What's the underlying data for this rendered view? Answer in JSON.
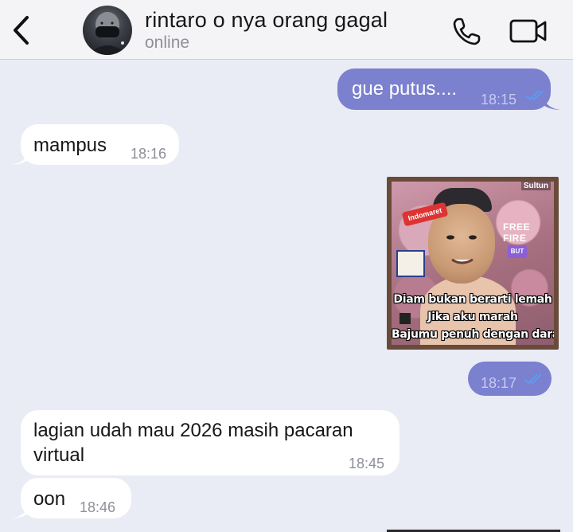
{
  "header": {
    "contact_name": "rintaro o nya orang gagal",
    "status": "online",
    "icons": {
      "back": "chevron-left-icon",
      "call": "phone-icon",
      "video": "video-camera-icon"
    }
  },
  "colors": {
    "background": "#e9ebf5",
    "outgoing_bubble": "#7b80cf",
    "incoming_bubble": "#ffffff",
    "read_tick": "#5b9bf0"
  },
  "messages": [
    {
      "direction": "out",
      "text": "gue putus....",
      "time": "18:15",
      "read": true
    },
    {
      "direction": "in",
      "text": "mampus",
      "time": "18:16"
    },
    {
      "direction": "out",
      "type": "image",
      "image": {
        "watermark": "Sultun",
        "sticker": "Indomaret",
        "logo": "FREE FIRE",
        "badge": "BUT",
        "caption_lines": [
          "Diam bukan berarti lemah",
          "Jika aku marah",
          "Bajumu penuh dengan darah"
        ]
      },
      "time": "18:17",
      "read": true
    },
    {
      "direction": "in",
      "text": "lagian udah mau 2026 masih pacaran\nvirtual",
      "time": "18:45"
    },
    {
      "direction": "in",
      "text": "oon",
      "time": "18:46"
    }
  ]
}
